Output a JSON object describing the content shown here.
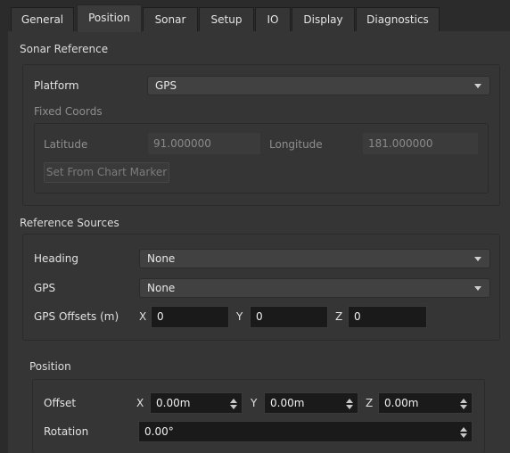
{
  "tabs": [
    {
      "label": "General"
    },
    {
      "label": "Position",
      "active": true
    },
    {
      "label": "Sonar"
    },
    {
      "label": "Setup"
    },
    {
      "label": "IO"
    },
    {
      "label": "Display"
    },
    {
      "label": "Diagnostics"
    }
  ],
  "sonar_reference": {
    "title": "Sonar Reference",
    "platform_label": "Platform",
    "platform_value": "GPS",
    "fixed_coords_title": "Fixed Coords",
    "latitude_label": "Latitude",
    "latitude_value": "91.000000",
    "longitude_label": "Longitude",
    "longitude_value": "181.000000",
    "set_from_chart_button": "Set From Chart Marker"
  },
  "reference_sources": {
    "title": "Reference Sources",
    "heading_label": "Heading",
    "heading_value": "None",
    "gps_label": "GPS",
    "gps_value": "None",
    "gps_offsets_label": "GPS Offsets (m)",
    "x_label": "X",
    "x_value": "0",
    "y_label": "Y",
    "y_value": "0",
    "z_label": "Z",
    "z_value": "0"
  },
  "position": {
    "title": "Position",
    "offset_label": "Offset",
    "x_label": "X",
    "x_value": "0.00m",
    "y_label": "Y",
    "y_value": "0.00m",
    "z_label": "Z",
    "z_value": "0.00m",
    "rotation_label": "Rotation",
    "rotation_value": "0.00°"
  }
}
